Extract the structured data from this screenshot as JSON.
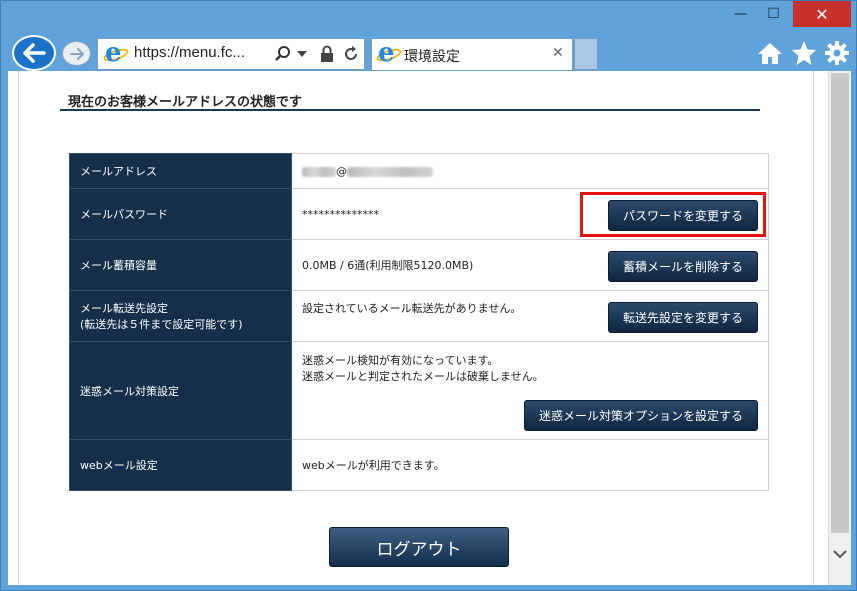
{
  "window": {
    "minimize_glyph": "—",
    "maximize_glyph": "☐",
    "close_glyph": "✕"
  },
  "toolbar": {
    "address": "https://menu.fc...",
    "tab_title": "環境設定",
    "tab_close": "✕"
  },
  "page": {
    "section_title": "現在のお客様メールアドレスの状態です",
    "rows": [
      {
        "label": "メールアドレス",
        "value_suffix": "@"
      },
      {
        "label": "メールパスワード",
        "value": "**************",
        "button": "パスワードを変更する"
      },
      {
        "label": "メール蓄積容量",
        "value": "0.0MB / 6通(利用制限5120.0MB)",
        "button": "蓄積メールを削除する"
      },
      {
        "label_line1": "メール転送先設定",
        "label_line2": "(転送先は５件まで設定可能です)",
        "value": "設定されているメール転送先がありません。",
        "button": "転送先設定を変更する"
      },
      {
        "label": "迷惑メール対策設定",
        "value_line1": "迷惑メール検知が有効になっています。",
        "value_line2": "迷惑メールと判定されたメールは破棄しません。",
        "button": "迷惑メール対策オプションを設定する"
      },
      {
        "label": "webメール設定",
        "value": "webメールが利用できます。"
      }
    ],
    "logout": "ログアウト"
  },
  "colors": {
    "label_bg": "#152e4a",
    "highlight": "#e3140e",
    "frame": "#5fa3da"
  }
}
